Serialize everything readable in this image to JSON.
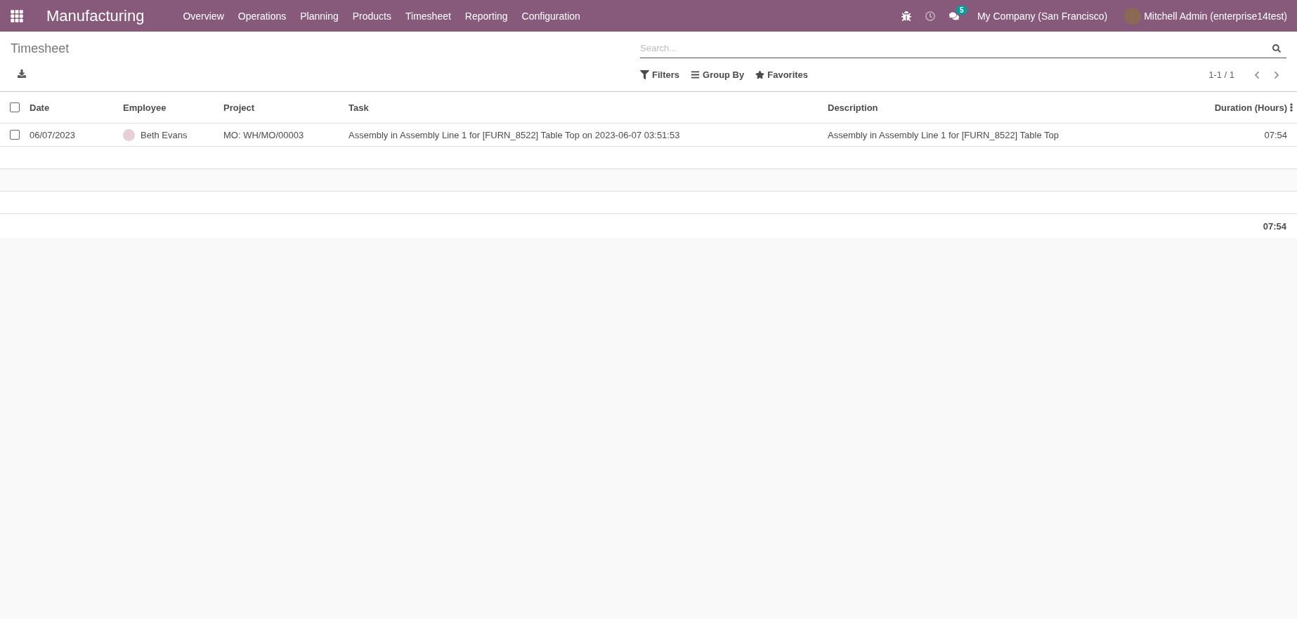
{
  "navbar": {
    "app_name": "Manufacturing",
    "menu": [
      "Overview",
      "Operations",
      "Planning",
      "Products",
      "Timesheet",
      "Reporting",
      "Configuration"
    ],
    "messages_badge": "5",
    "company": "My Company (San Francisco)",
    "user": "Mitchell Admin (enterprise14test)"
  },
  "control_panel": {
    "title": "Timesheet",
    "search": {
      "placeholder": "Search..."
    },
    "filters": [
      "Filters",
      "Group By",
      "Favorites"
    ],
    "pager": "1-1 / 1"
  },
  "table": {
    "select_all": {
      "checked": false
    },
    "columns": [
      "Date",
      "Employee",
      "Project",
      "Task",
      "Description",
      "Duration (Hours)"
    ],
    "rows": [
      {
        "checked": false,
        "date": "06/07/2023",
        "employee": "Beth Evans",
        "project": "MO: WH/MO/00003",
        "task": "Assembly in Assembly Line 1 for [FURN_8522] Table Top on 2023-06-07 03:51:53",
        "description": "Assembly in Assembly Line 1 for [FURN_8522] Table Top",
        "duration": "07:54"
      }
    ],
    "total": "07:54"
  }
}
